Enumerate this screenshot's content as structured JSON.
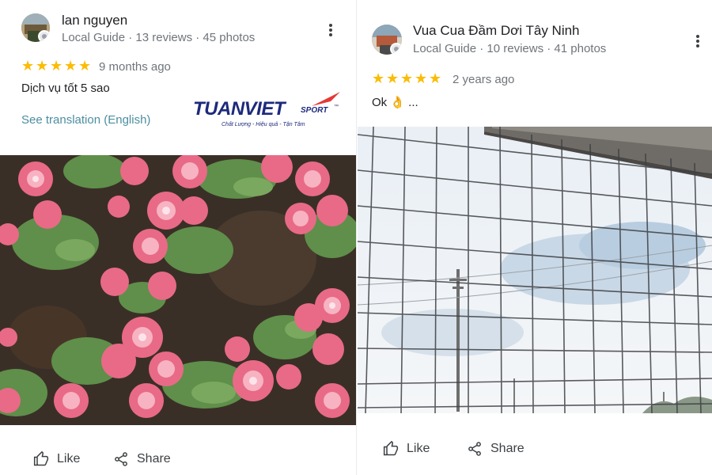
{
  "reviews": [
    {
      "reviewer_name": "lan nguyen",
      "reviewer_meta": "Local Guide · 13 reviews · 45 photos",
      "rating_stars": 5,
      "rating_symbol": "★",
      "time_ago": "9 months ago",
      "text": "Dịch vụ tốt 5 sao",
      "translate_link": "See translation (English)",
      "watermark": {
        "brand": "TUANVIET",
        "sub": "SPORT",
        "trademark": "™",
        "tagline": "Chất Lượng - Hiệu quả - Tận Tâm"
      },
      "photo_icon": "pink-begonia-flowers-photo",
      "like_label": "Like",
      "share_label": "Share"
    },
    {
      "reviewer_name": "Vua Cua Đầm Dơi Tây Ninh",
      "reviewer_meta": "Local Guide · 10 reviews · 41 photos",
      "rating_stars": 5,
      "rating_symbol": "★",
      "time_ago": "2 years ago",
      "text": "Ok 👌 ...",
      "photo_icon": "sports-net-sky-photo",
      "like_label": "Like",
      "share_label": "Share"
    }
  ],
  "colors": {
    "star": "#fbbc04",
    "link": "#4c8ea0",
    "muted": "#70757a",
    "brand": "#1d2a7c",
    "brand_accent": "#e53935"
  }
}
